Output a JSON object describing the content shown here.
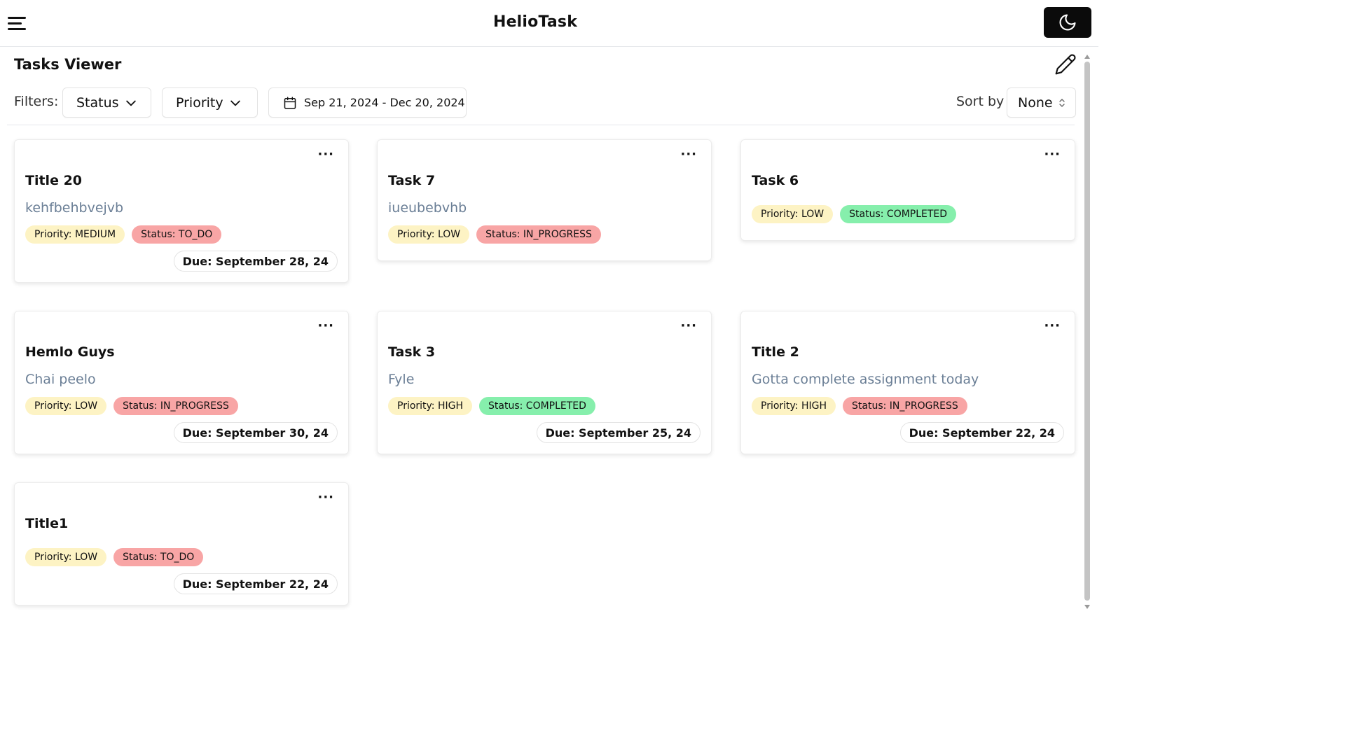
{
  "header": {
    "app_title": "HelioTask",
    "menu_icon": "hamburger-menu-icon",
    "theme_icon": "moon-icon"
  },
  "toolbar": {
    "page_title": "Tasks Viewer",
    "filters_label": "Filters:",
    "status_filter_label": "Status",
    "priority_filter_label": "Priority",
    "date_range": "Sep 21, 2024 - Dec 20, 2024",
    "sort_label": "Sort by",
    "sort_value": "None"
  },
  "colors": {
    "priority_tag": "#fdf3c4",
    "status_red": "#f8a5a5",
    "status_green": "#86efac",
    "description": "#6b7f96",
    "theme_button": "#0b0b0b"
  },
  "tasks": [
    {
      "title": "Title 20",
      "description": "kehfbehbvejvb",
      "priority": "Priority: MEDIUM",
      "status": "Status: TO_DO",
      "due": "Due: September 28, 24"
    },
    {
      "title": "Task 7",
      "description": "iueubebvhb",
      "priority": "Priority: LOW",
      "status": "Status: IN_PROGRESS",
      "due": ""
    },
    {
      "title": "Task 6",
      "description": "",
      "priority": "Priority: LOW",
      "status": "Status: COMPLETED",
      "due": ""
    },
    {
      "title": "Hemlo Guys",
      "description": "Chai peelo",
      "priority": "Priority: LOW",
      "status": "Status: IN_PROGRESS",
      "due": "Due: September 30, 24"
    },
    {
      "title": "Task 3",
      "description": "Fyle",
      "priority": "Priority: HIGH",
      "status": "Status: COMPLETED",
      "due": "Due: September 25, 24"
    },
    {
      "title": "Title 2",
      "description": "Gotta complete assignment today",
      "priority": "Priority: HIGH",
      "status": "Status: IN_PROGRESS",
      "due": "Due: September 22, 24"
    },
    {
      "title": "Title1",
      "description": "",
      "priority": "Priority: LOW",
      "status": "Status: TO_DO",
      "due": "Due: September 22, 24"
    }
  ]
}
